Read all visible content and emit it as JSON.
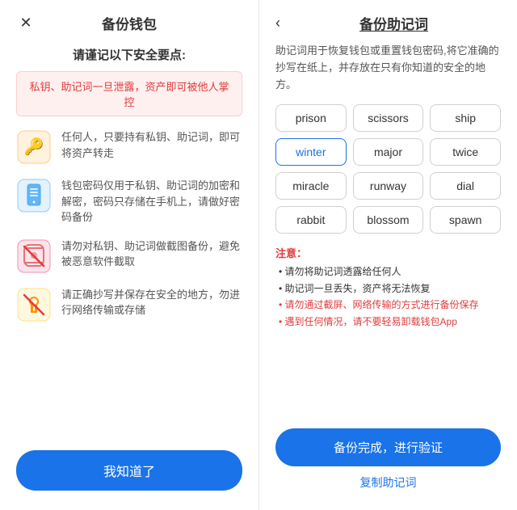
{
  "left": {
    "title": "备份钱包",
    "close_icon": "✕",
    "safety_heading": "请谨记以下安全要点:",
    "warning": "私钥、助记词一旦泄露，资产即可被他人掌控",
    "items": [
      {
        "id": "item-key",
        "text": "任何人，只要持有私钥、助记词，即可将资产转走"
      },
      {
        "id": "item-password",
        "text": "钱包密码仅用于私钥、助记词的加密和解密，密码只存储在手机上，请做好密码备份"
      },
      {
        "id": "item-screenshot",
        "text": "请勿对私钥、助记词做截图备份，避免被恶意软件截取"
      },
      {
        "id": "item-safe",
        "text": "请正确抄写并保存在安全的地方，勿进行网络传输或存储"
      }
    ],
    "bottom_btn": "我知道了"
  },
  "right": {
    "back_icon": "‹",
    "title": "备份助记词",
    "desc": "助记词用于恢复钱包或重置钱包密码,将它准确的抄写在纸上，并存放在只有你知道的安全的地方。",
    "words": [
      {
        "text": "prison",
        "highlight": false
      },
      {
        "text": "scissors",
        "highlight": false
      },
      {
        "text": "ship",
        "highlight": false
      },
      {
        "text": "winter",
        "highlight": true
      },
      {
        "text": "major",
        "highlight": false
      },
      {
        "text": "twice",
        "highlight": false
      },
      {
        "text": "miracle",
        "highlight": false
      },
      {
        "text": "runway",
        "highlight": false
      },
      {
        "text": "dial",
        "highlight": false
      },
      {
        "text": "rabbit",
        "highlight": false
      },
      {
        "text": "blossom",
        "highlight": false
      },
      {
        "text": "spawn",
        "highlight": false
      }
    ],
    "notes_title": "注意：",
    "notes": [
      {
        "text": "• 请勿将助记词透露给任何人",
        "red": false
      },
      {
        "text": "• 助记词一旦丢失，资产将无法恢复",
        "red": false
      },
      {
        "text": "• 请勿通过截屏、网络传输的方式进行备份保存",
        "red": true
      },
      {
        "text": "• 遇到任何情况，请不要轻易卸载钱包App",
        "red": true
      }
    ],
    "primary_btn": "备份完成，进行验证",
    "copy_link": "复制助记词"
  }
}
